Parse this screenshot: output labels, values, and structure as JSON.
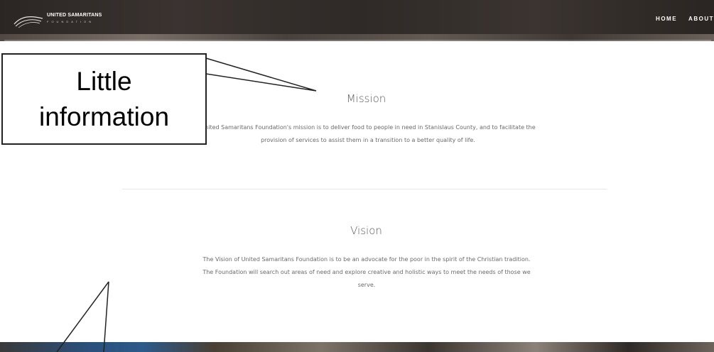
{
  "header": {
    "logo_main": "UNITED SAMARITANS",
    "logo_sub": "FOUNDATION",
    "nav": [
      {
        "label": "HOME"
      },
      {
        "label": "ABOUT"
      }
    ]
  },
  "mission": {
    "title": "Mission",
    "body": "United Samaritans Foundation's mission is to deliver food to people in need in Stanislaus County, and to facilitate the provision of services to assist them in a transition to a better quality of life."
  },
  "vision": {
    "title": "Vision",
    "body": "The Vision of United Samaritans Foundation is to be an advocate for the poor in the spirit of the Christian tradition. The Foundation will search out areas of need and explore creative and holistic ways to meet the needs of those we serve."
  },
  "annotation": {
    "callout_text": "Little\ninformation"
  },
  "colors": {
    "header_bg": "#2b2624",
    "text_muted": "#6a6a6a",
    "title": "#5b5b5b"
  },
  "icons": {
    "logo": "swoosh-logo-icon"
  }
}
